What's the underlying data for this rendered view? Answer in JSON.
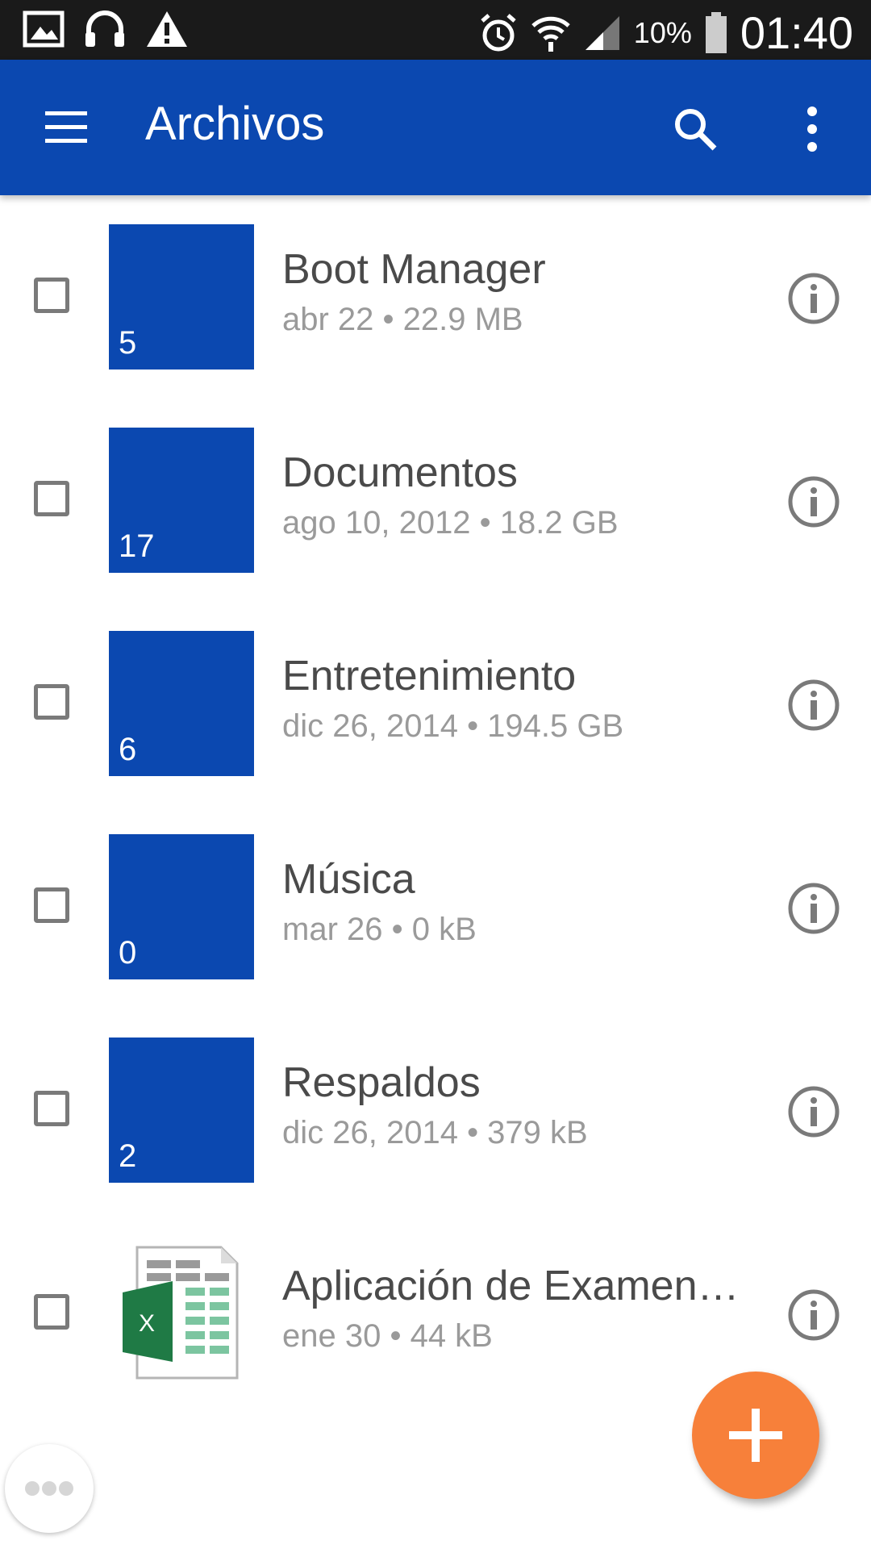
{
  "status_bar": {
    "battery_percent": "10%",
    "time": "01:40",
    "icons": [
      "gallery-icon",
      "headphones-icon",
      "warning-icon",
      "alarm-icon",
      "wifi-icon",
      "signal-icon",
      "battery-icon"
    ]
  },
  "app_bar": {
    "title": "Archivos",
    "icons": [
      "menu-icon",
      "search-icon",
      "more-vert-icon"
    ]
  },
  "files": [
    {
      "type": "folder",
      "name": "Boot Manager",
      "meta": "abr 22 • 22.9 MB",
      "count": "5"
    },
    {
      "type": "folder",
      "name": "Documentos",
      "meta": "ago 10, 2012 • 18.2 GB",
      "count": "17"
    },
    {
      "type": "folder",
      "name": "Entretenimiento",
      "meta": "dic 26, 2014 • 194.5 GB",
      "count": "6"
    },
    {
      "type": "folder",
      "name": "Música",
      "meta": "mar 26 • 0 kB",
      "count": "0"
    },
    {
      "type": "folder",
      "name": "Respaldos",
      "meta": "dic 26, 2014 • 379 kB",
      "count": "2"
    },
    {
      "type": "excel",
      "name": "Aplicación de Examen…",
      "meta": "ene 30 • 44 kB",
      "count": null
    }
  ],
  "colors": {
    "app_bar": "#0b48b0",
    "folder": "#0b48b0",
    "fab": "#f7803a",
    "status_bar": "#1a1a1a"
  }
}
